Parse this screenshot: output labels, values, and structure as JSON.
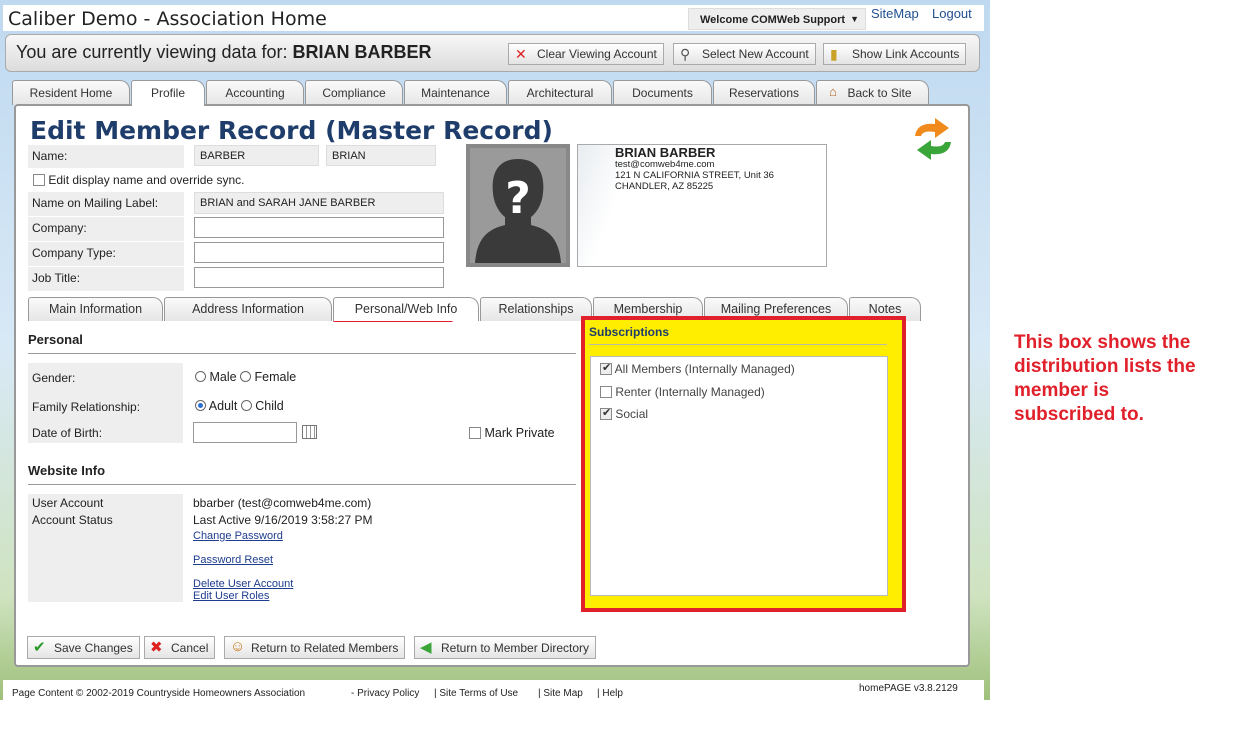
{
  "app": {
    "title": "Caliber Demo - Association Home",
    "welcome": "Welcome COMWeb Support",
    "sitemap": "SiteMap",
    "logout": "Logout"
  },
  "viewing": {
    "prefix": "You are currently viewing data for:",
    "name": "BRIAN BARBER",
    "clear": "Clear Viewing Account",
    "select": "Select New Account",
    "show_links": "Show Link Accounts"
  },
  "tabs": [
    "Resident Home",
    "Profile",
    "Accounting",
    "Compliance",
    "Maintenance",
    "Architectural",
    "Documents",
    "Reservations",
    "Back to Site"
  ],
  "page": {
    "heading": "Edit Member Record (Master Record)"
  },
  "form": {
    "name_label": "Name:",
    "last_name": "BARBER",
    "first_name": "BRIAN",
    "override_label": "Edit display name and override sync.",
    "mailing_label": "Name on Mailing Label:",
    "mailing_value": "BRIAN and SARAH JANE BARBER",
    "company_label": "Company:",
    "company_type_label": "Company Type:",
    "job_title_label": "Job Title:"
  },
  "card": {
    "name": "BRIAN BARBER",
    "email": "test@comweb4me.com",
    "street": "121 N CALIFORNIA STREET, Unit 36",
    "city": "CHANDLER, AZ 85225"
  },
  "subtabs": [
    "Main Information",
    "Address Information",
    "Personal/Web Info",
    "Relationships",
    "Membership",
    "Mailing Preferences",
    "Notes"
  ],
  "personal": {
    "heading": "Personal",
    "gender_label": "Gender:",
    "male": "Male",
    "female": "Female",
    "family_label": "Family Relationship:",
    "adult": "Adult",
    "child": "Child",
    "dob_label": "Date of Birth:",
    "mark_private": "Mark Private"
  },
  "website": {
    "heading": "Website Info",
    "user_account_label": "User Account",
    "account_status_label": "Account Status",
    "user_account": "bbarber (test@comweb4me.com)",
    "last_active": "Last Active 9/16/2019 3:58:27 PM",
    "change_password": "Change Password",
    "password_reset": "Password Reset",
    "delete_user": "Delete User Account",
    "edit_roles": "Edit User Roles"
  },
  "subscriptions": {
    "heading": "Subscriptions",
    "items": [
      {
        "label": "All Members (Internally Managed)",
        "checked": true
      },
      {
        "label": "Renter (Internally Managed)",
        "checked": false
      },
      {
        "label": "Social",
        "checked": true
      }
    ]
  },
  "buttons": {
    "save": "Save Changes",
    "cancel": "Cancel",
    "return_related": "Return to Related Members",
    "return_directory": "Return to Member Directory"
  },
  "footer": {
    "copyright": "Page Content © 2002-2019 Countryside Homeowners Association",
    "privacy": "- Privacy Policy",
    "terms": "| Site Terms of Use",
    "sitemap": "| Site Map",
    "help": "| Help",
    "version": "homePAGE v3.8.2129"
  },
  "annotation": "This box shows the distribution lists the member is subscribed to.",
  "colors": {
    "accent": "#1f3d6b",
    "highlight": "#ffee00",
    "alert": "#e0202a"
  }
}
